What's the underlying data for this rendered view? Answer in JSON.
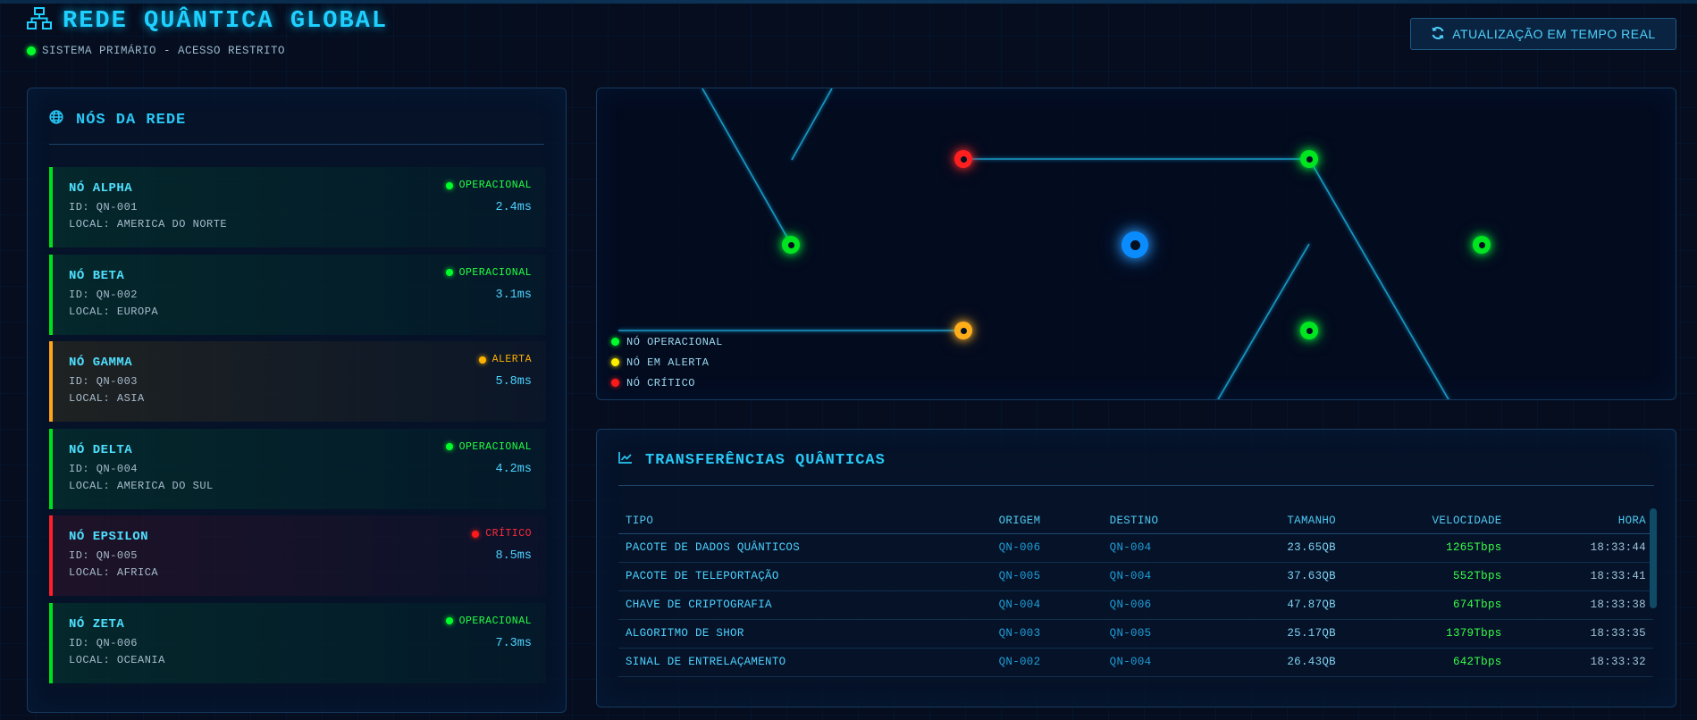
{
  "header": {
    "title": "REDE QUÂNTICA GLOBAL",
    "status_text": "SISTEMA PRIMÁRIO - ACESSO RESTRITO",
    "realtime_button": "ATUALIZAÇÃO EM TEMPO REAL",
    "icons": {
      "title": "network-icon",
      "button": "refresh-icon",
      "status": "green-dot"
    }
  },
  "nodes_panel": {
    "title": "NÓS DA REDE",
    "icon": "globe-icon",
    "nodes": [
      {
        "name": "NÓ ALPHA",
        "id": "ID: QN-001",
        "location": "LOCAL: AMERICA DO NORTE",
        "status": "OPERACIONAL",
        "latency": "2.4ms",
        "state": "op"
      },
      {
        "name": "NÓ BETA",
        "id": "ID: QN-002",
        "location": "LOCAL: EUROPA",
        "status": "OPERACIONAL",
        "latency": "3.1ms",
        "state": "op"
      },
      {
        "name": "NÓ GAMMA",
        "id": "ID: QN-003",
        "location": "LOCAL: ASIA",
        "status": "ALERTA",
        "latency": "5.8ms",
        "state": "alert"
      },
      {
        "name": "NÓ DELTA",
        "id": "ID: QN-004",
        "location": "LOCAL: AMERICA DO SUL",
        "status": "OPERACIONAL",
        "latency": "4.2ms",
        "state": "op"
      },
      {
        "name": "NÓ EPSILON",
        "id": "ID: QN-005",
        "location": "LOCAL: AFRICA",
        "status": "CRÍTICO",
        "latency": "8.5ms",
        "state": "crit"
      },
      {
        "name": "NÓ ZETA",
        "id": "ID: QN-006",
        "location": "LOCAL: OCEANIA",
        "status": "OPERACIONAL",
        "latency": "7.3ms",
        "state": "op"
      }
    ]
  },
  "map": {
    "legend": [
      {
        "label": "NÓ OPERACIONAL",
        "color": "#00ff2a"
      },
      {
        "label": "NÓ EM ALERTA",
        "color": "#ffee00"
      },
      {
        "label": "NÓ CRÍTICO",
        "color": "#ff1a1a"
      }
    ],
    "colors": {
      "operational": "#00e51f",
      "alert": "#ffae1a",
      "critical": "#ff1f1f",
      "hub": "#0a8cff",
      "link": "#1aa8d8"
    }
  },
  "transfers_panel": {
    "title": "TRANSFERÊNCIAS QUÂNTICAS",
    "icon": "chart-line-icon",
    "columns": [
      "TIPO",
      "ORIGEM",
      "DESTINO",
      "TAMANHO",
      "VELOCIDADE",
      "HORA"
    ],
    "rows": [
      {
        "tipo": "PACOTE DE DADOS QUÂNTICOS",
        "origem": "QN-006",
        "destino": "QN-004",
        "tamanho": "23.65QB",
        "velocidade": "1265Tbps",
        "hora": "18:33:44"
      },
      {
        "tipo": "PACOTE DE TELEPORTAÇÃO",
        "origem": "QN-005",
        "destino": "QN-004",
        "tamanho": "37.63QB",
        "velocidade": "552Tbps",
        "hora": "18:33:41"
      },
      {
        "tipo": "CHAVE DE CRIPTOGRAFIA",
        "origem": "QN-004",
        "destino": "QN-006",
        "tamanho": "47.87QB",
        "velocidade": "674Tbps",
        "hora": "18:33:38"
      },
      {
        "tipo": "ALGORITMO DE SHOR",
        "origem": "QN-003",
        "destino": "QN-005",
        "tamanho": "25.17QB",
        "velocidade": "1379Tbps",
        "hora": "18:33:35"
      },
      {
        "tipo": "SINAL DE ENTRELAÇAMENTO",
        "origem": "QN-002",
        "destino": "QN-004",
        "tamanho": "26.43QB",
        "velocidade": "642Tbps",
        "hora": "18:33:32"
      }
    ]
  }
}
